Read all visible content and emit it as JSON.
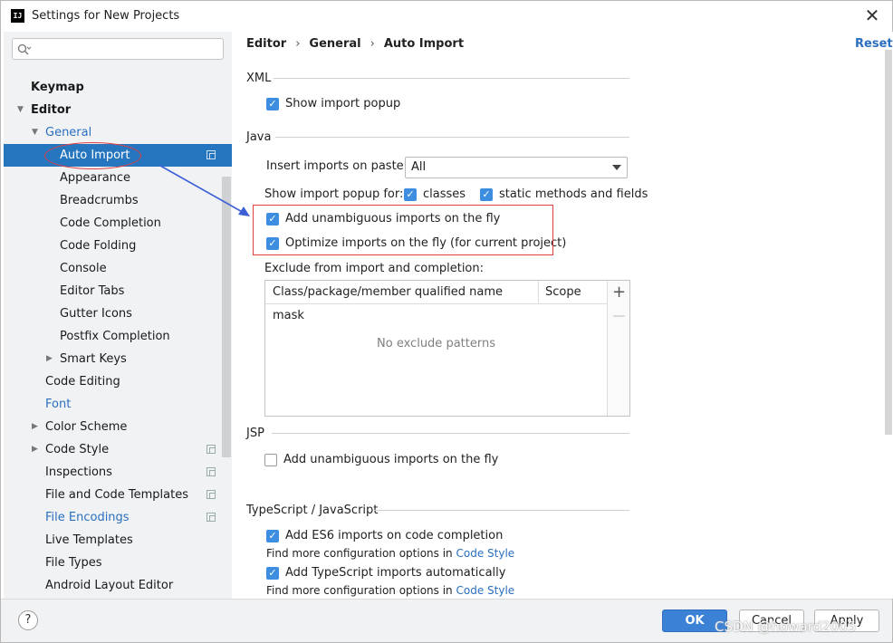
{
  "window": {
    "title": "Settings for New Projects",
    "app_icon_text": "IJ"
  },
  "search": {
    "placeholder": ""
  },
  "sidebar": {
    "items": [
      {
        "label": "Keymap",
        "indent": 0,
        "bold": true
      },
      {
        "label": "Editor",
        "indent": 0,
        "bold": true,
        "expanded": true
      },
      {
        "label": "General",
        "indent": 1,
        "expanded": true,
        "blue": true
      },
      {
        "label": "Auto Import",
        "indent": 2,
        "selected": true
      },
      {
        "label": "Appearance",
        "indent": 2
      },
      {
        "label": "Breadcrumbs",
        "indent": 2
      },
      {
        "label": "Code Completion",
        "indent": 2
      },
      {
        "label": "Code Folding",
        "indent": 2
      },
      {
        "label": "Console",
        "indent": 2
      },
      {
        "label": "Editor Tabs",
        "indent": 2
      },
      {
        "label": "Gutter Icons",
        "indent": 2
      },
      {
        "label": "Postfix Completion",
        "indent": 2
      },
      {
        "label": "Smart Keys",
        "indent": 2,
        "collapsed": true
      },
      {
        "label": "Code Editing",
        "indent": 1
      },
      {
        "label": "Font",
        "indent": 1,
        "blue": true
      },
      {
        "label": "Color Scheme",
        "indent": 1,
        "collapsed": true
      },
      {
        "label": "Code Style",
        "indent": 1,
        "collapsed": true
      },
      {
        "label": "Inspections",
        "indent": 1
      },
      {
        "label": "File and Code Templates",
        "indent": 1
      },
      {
        "label": "File Encodings",
        "indent": 1,
        "blue": true
      },
      {
        "label": "Live Templates",
        "indent": 1
      },
      {
        "label": "File Types",
        "indent": 1
      },
      {
        "label": "Android Layout Editor",
        "indent": 1
      }
    ]
  },
  "breadcrumb": {
    "part1": "Editor",
    "part2": "General",
    "part3": "Auto Import",
    "separator": "›"
  },
  "reset_label": "Reset",
  "xml": {
    "title": "XML",
    "show_import_popup": "Show import popup"
  },
  "java": {
    "title": "Java",
    "insert_on_paste_label": "Insert imports on paste:",
    "insert_on_paste_value": "All",
    "show_popup_for_label": "Show import popup for:",
    "classes_label": "classes",
    "static_methods_label": "static methods and fields",
    "add_unambiguous": "Add unambiguous imports on the fly",
    "optimize_imports": "Optimize imports on the fly (for current project)",
    "exclude_label": "Exclude from import and completion:",
    "table": {
      "columns": [
        "Class/package/member qualified name mask",
        "Scope"
      ],
      "empty_text": "No exclude patterns",
      "add_tool": "+",
      "remove_tool": "—"
    }
  },
  "jsp": {
    "title": "JSP",
    "add_unambiguous": "Add unambiguous imports on the fly"
  },
  "ts": {
    "title": "TypeScript / JavaScript",
    "es6_label": "Add ES6 imports on code completion",
    "note_prefix": "Find more configuration options in ",
    "note_link": "Code Style",
    "ts_auto_label": "Add TypeScript imports automatically",
    "note2_prefix": "Find more configuration options in ",
    "note2_link": "Code Style"
  },
  "footer": {
    "help": "?",
    "ok": "OK",
    "cancel": "Cancel",
    "apply": "Apply"
  },
  "watermark": "CSDN @howard2005",
  "colors": {
    "accent": "#3b82d6",
    "selection": "#2675bf",
    "link": "#2a6fbf",
    "annotation": "#e0403f",
    "arrow": "#3c5fd6"
  }
}
